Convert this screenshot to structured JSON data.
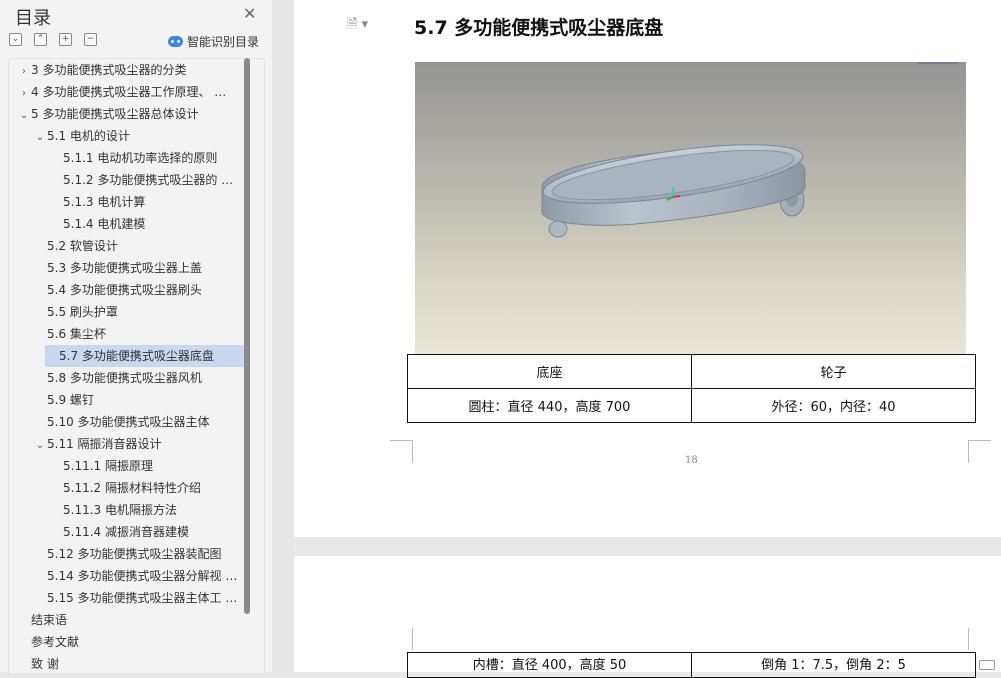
{
  "sidebar": {
    "title": "目录",
    "smart_label": "智能识别目录",
    "tools": [
      "⌄",
      "⌃",
      "+",
      "−"
    ],
    "items": [
      {
        "label": "3  多功能便携式吸尘器的分类",
        "level": 0,
        "chev": "›",
        "selected": false
      },
      {
        "label": "4  多功能便携式吸尘器工作原理、 …",
        "level": 0,
        "chev": "›",
        "selected": false
      },
      {
        "label": "5  多功能便携式吸尘器总体设计",
        "level": 0,
        "chev": "⌄",
        "selected": false
      },
      {
        "label": "5.1 电机的设计",
        "level": 1,
        "chev": "⌄",
        "selected": false
      },
      {
        "label": "5.1.1 电动机功率选择的原则",
        "level": 2,
        "chev": "",
        "selected": false
      },
      {
        "label": "5.1.2 多功能便携式吸尘器的 …",
        "level": 2,
        "chev": "",
        "selected": false
      },
      {
        "label": "5.1.3 电机计算",
        "level": 2,
        "chev": "",
        "selected": false
      },
      {
        "label": "5.1.4 电机建模",
        "level": 2,
        "chev": "",
        "selected": false
      },
      {
        "label": "5.2 软管设计",
        "level": 1,
        "chev": "",
        "selected": false
      },
      {
        "label": "5.3 多功能便携式吸尘器上盖",
        "level": 1,
        "chev": "",
        "selected": false
      },
      {
        "label": "5.4 多功能便携式吸尘器刷头",
        "level": 1,
        "chev": "",
        "selected": false
      },
      {
        "label": "5.5 刷头护罩",
        "level": 1,
        "chev": "",
        "selected": false
      },
      {
        "label": "5.6 集尘杯",
        "level": 1,
        "chev": "",
        "selected": false
      },
      {
        "label": "5.7 多功能便携式吸尘器底盘",
        "level": 1,
        "chev": "",
        "selected": true
      },
      {
        "label": "5.8 多功能便携式吸尘器风机",
        "level": 1,
        "chev": "",
        "selected": false
      },
      {
        "label": "5.9 螺钉",
        "level": 1,
        "chev": "",
        "selected": false
      },
      {
        "label": "5.10 多功能便携式吸尘器主体",
        "level": 1,
        "chev": "",
        "selected": false
      },
      {
        "label": "5.11 隔振消音器设计",
        "level": 1,
        "chev": "⌄",
        "selected": false
      },
      {
        "label": "5.11.1 隔振原理",
        "level": 2,
        "chev": "",
        "selected": false
      },
      {
        "label": "5.11.2 隔振材料特性介绍",
        "level": 2,
        "chev": "",
        "selected": false
      },
      {
        "label": "5.11.3 电机隔振方法",
        "level": 2,
        "chev": "",
        "selected": false
      },
      {
        "label": "5.11.4 减振消音器建模",
        "level": 2,
        "chev": "",
        "selected": false
      },
      {
        "label": "5.12 多功能便携式吸尘器装配图",
        "level": 1,
        "chev": "",
        "selected": false
      },
      {
        "label": "5.14 多功能便携式吸尘器分解视 …",
        "level": 1,
        "chev": "",
        "selected": false
      },
      {
        "label": "5.15 多功能便携式吸尘器主体工 …",
        "level": 1,
        "chev": "",
        "selected": false
      },
      {
        "label": "结束语",
        "level": 0,
        "chev": "",
        "selected": false
      },
      {
        "label": "参考文献",
        "level": 0,
        "chev": "",
        "selected": false
      },
      {
        "label": "致  谢",
        "level": 0,
        "chev": "",
        "selected": false
      }
    ]
  },
  "document": {
    "heading": "5.7 多功能便携式吸尘器底盘",
    "table1": {
      "headers": [
        "底座",
        "轮子"
      ],
      "row": [
        "圆柱：直径 440，高度 700",
        "外径：60，内径：40"
      ]
    },
    "page_number": "18",
    "table2": {
      "row": [
        "内槽：直径 400，高度 50",
        "倒角 1：7.5，倒角 2：5"
      ]
    }
  },
  "colors": {
    "selected_bg": "#c9d7f0",
    "accent": "#3b86e8"
  }
}
